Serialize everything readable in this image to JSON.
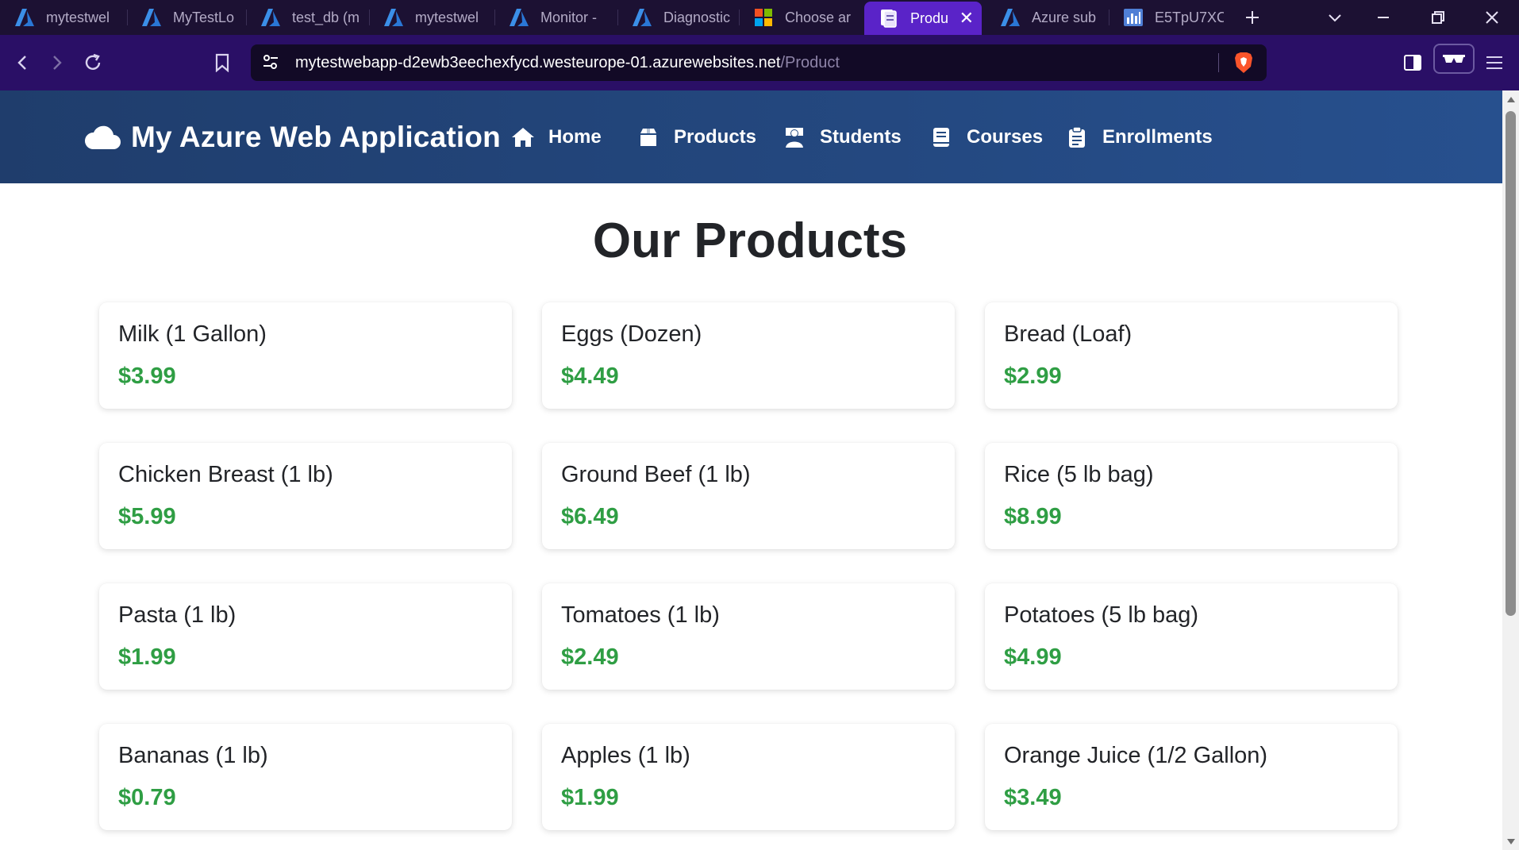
{
  "browser": {
    "tabs": [
      {
        "label": "mytestwel",
        "icon": "azure-icon",
        "active": false
      },
      {
        "label": "MyTestLo",
        "icon": "azure-icon",
        "active": false
      },
      {
        "label": "test_db (m",
        "icon": "azure-icon",
        "active": false
      },
      {
        "label": "mytestwel",
        "icon": "azure-icon",
        "active": false
      },
      {
        "label": "Monitor -",
        "icon": "azure-icon",
        "active": false
      },
      {
        "label": "Diagnostic",
        "icon": "azure-icon",
        "active": false
      },
      {
        "label": "Choose ar",
        "icon": "microsoft-icon",
        "active": false
      },
      {
        "label": "Produ",
        "icon": "page-icon",
        "active": true
      },
      {
        "label": "Azure sub",
        "icon": "azure-icon",
        "active": false
      },
      {
        "label": "E5TpU7XC",
        "icon": "chart-icon",
        "active": false
      }
    ],
    "url_host": "mytestwebapp-d2ewb3eechexfycd.westeurope-01.azurewebsites.net",
    "url_path": "/Product"
  },
  "site": {
    "brand": "My Azure Web Application",
    "nav": [
      {
        "label": "Home",
        "icon": "home-icon"
      },
      {
        "label": "Products",
        "icon": "box-icon"
      },
      {
        "label": "Students",
        "icon": "student-icon"
      },
      {
        "label": "Courses",
        "icon": "book-icon"
      },
      {
        "label": "Enrollments",
        "icon": "clipboard-icon"
      }
    ]
  },
  "page": {
    "title": "Our Products",
    "products": [
      {
        "name": "Milk (1 Gallon)",
        "price": "$3.99"
      },
      {
        "name": "Eggs (Dozen)",
        "price": "$4.49"
      },
      {
        "name": "Bread (Loaf)",
        "price": "$2.99"
      },
      {
        "name": "Chicken Breast (1 lb)",
        "price": "$5.99"
      },
      {
        "name": "Ground Beef (1 lb)",
        "price": "$6.49"
      },
      {
        "name": "Rice (5 lb bag)",
        "price": "$8.99"
      },
      {
        "name": "Pasta (1 lb)",
        "price": "$1.99"
      },
      {
        "name": "Tomatoes (1 lb)",
        "price": "$2.49"
      },
      {
        "name": "Potatoes (5 lb bag)",
        "price": "$4.99"
      },
      {
        "name": "Bananas (1 lb)",
        "price": "$0.79"
      },
      {
        "name": "Apples (1 lb)",
        "price": "$1.99"
      },
      {
        "name": "Orange Juice (1/2 Gallon)",
        "price": "$3.49"
      }
    ]
  },
  "colors": {
    "tabstrip_bg": "#1c1133",
    "active_tab": "#5a23c8",
    "toolbar_bg": "#2a0f66",
    "header_start": "#1f3d6c",
    "header_end": "#27508e",
    "price_green": "#2f9e44",
    "brave_orange": "#fb542b"
  }
}
